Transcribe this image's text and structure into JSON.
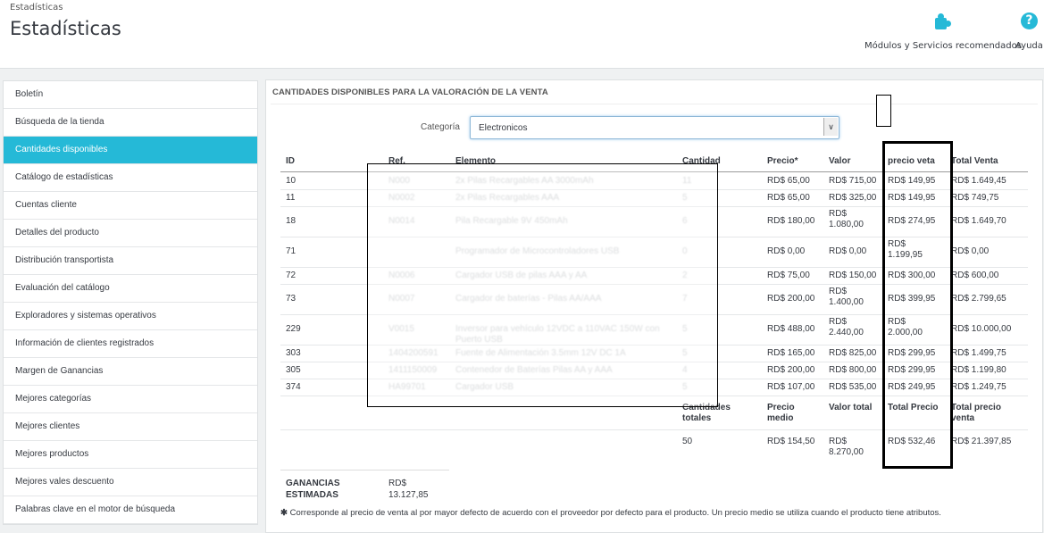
{
  "breadcrumb": "Estadísticas",
  "page_title": "Estadísticas",
  "toolbar": {
    "modules_label": "Módulos y Servicios recomendados",
    "help_label": "Ayuda",
    "modules_icon": "puzzle-icon",
    "help_icon": "question-circle-icon"
  },
  "colors": {
    "accent": "#25b9d7"
  },
  "sidebar": {
    "items": [
      {
        "label": "Boletín"
      },
      {
        "label": "Búsqueda de la tienda"
      },
      {
        "label": "Cantidades disponibles",
        "active": true
      },
      {
        "label": "Catálogo de estadísticas"
      },
      {
        "label": "Cuentas cliente"
      },
      {
        "label": "Detalles del producto"
      },
      {
        "label": "Distribución transportista"
      },
      {
        "label": "Evaluación del catálogo"
      },
      {
        "label": "Exploradores y sistemas operativos"
      },
      {
        "label": "Información de clientes registrados"
      },
      {
        "label": "Margen de Ganancias"
      },
      {
        "label": "Mejores categorías"
      },
      {
        "label": "Mejores clientes"
      },
      {
        "label": "Mejores productos"
      },
      {
        "label": "Mejores vales descuento"
      },
      {
        "label": "Palabras clave en el motor de búsqueda"
      }
    ]
  },
  "panel": {
    "title": "CANTIDADES DISPONIBLES PARA LA VALORACIÓN DE LA VENTA",
    "category_label": "Categoría",
    "category_value": "Electronicos"
  },
  "table": {
    "headers": [
      "ID",
      "Ref.",
      "Elemento",
      "Cantidad",
      "Precio*",
      "Valor",
      "precio veta",
      "Total Venta"
    ],
    "rows": [
      {
        "id": "10",
        "ref": "N000",
        "item": "2x Pilas Recargables AA 3000mAh",
        "qty": "11",
        "price": "RD$ 65,00",
        "value": "RD$ 715,00",
        "sale": "RD$ 149,95",
        "total": "RD$ 1.649,45"
      },
      {
        "id": "11",
        "ref": "N0002",
        "item": "2x Pilas Recargables AAA",
        "qty": "5",
        "price": "RD$ 65,00",
        "value": "RD$ 325,00",
        "sale": "RD$ 149,95",
        "total": "RD$ 749,75"
      },
      {
        "id": "18",
        "ref": "N0014",
        "item": "Pila Recargable 9V 450mAh",
        "qty": "6",
        "price": "RD$ 180,00",
        "value": "RD$ 1.080,00",
        "sale": "RD$ 274,95",
        "total": "RD$ 1.649,70"
      },
      {
        "id": "71",
        "ref": "",
        "item": "Programador de Microcontroladores USB",
        "qty": "0",
        "price": "RD$ 0,00",
        "value": "RD$ 0,00",
        "sale": "RD$ 1.199,95",
        "total": "RD$ 0,00"
      },
      {
        "id": "72",
        "ref": "N0006",
        "item": "Cargador USB de pilas AAA y AA",
        "qty": "2",
        "price": "RD$ 75,00",
        "value": "RD$ 150,00",
        "sale": "RD$ 300,00",
        "total": "RD$ 600,00"
      },
      {
        "id": "73",
        "ref": "N0007",
        "item": "Cargador de baterías - Pilas AA/AAA",
        "qty": "7",
        "price": "RD$ 200,00",
        "value": "RD$ 1.400,00",
        "sale": "RD$ 399,95",
        "total": "RD$ 2.799,65"
      },
      {
        "id": "229",
        "ref": "V0015",
        "item": "Inversor para vehículo 12VDC a 110VAC 150W con Puerto USB",
        "qty": "5",
        "price": "RD$ 488,00",
        "value": "RD$ 2.440,00",
        "sale": "RD$ 2.000,00",
        "total": "RD$ 10.000,00"
      },
      {
        "id": "303",
        "ref": "1404200591",
        "item": "Fuente de Alimentación 3.5mm 12V DC 1A",
        "qty": "5",
        "price": "RD$ 165,00",
        "value": "RD$ 825,00",
        "sale": "RD$ 299,95",
        "total": "RD$ 1.499,75"
      },
      {
        "id": "305",
        "ref": "1411150009",
        "item": "Contenedor de Baterías Pilas AA y AAA",
        "qty": "4",
        "price": "RD$ 200,00",
        "value": "RD$ 800,00",
        "sale": "RD$ 299,95",
        "total": "RD$ 1.199,80"
      },
      {
        "id": "374",
        "ref": "HA99701",
        "item": "Cargador USB",
        "qty": "5",
        "price": "RD$ 107,00",
        "value": "RD$ 535,00",
        "sale": "RD$ 249,95",
        "total": "RD$ 1.249,75"
      }
    ],
    "totals_headers": {
      "qty": "Cantidades totales",
      "price": "Precio medio",
      "value": "Valor total",
      "sale": "Total Precio",
      "total": "Total precio venta"
    },
    "totals": {
      "qty": "50",
      "price": "RD$ 154,50",
      "value": "RD$ 8.270,00",
      "sale": "RD$ 532,46",
      "total": "RD$ 21.397,85"
    }
  },
  "earnings": {
    "label": "GANANCIAS ESTIMADAS",
    "value": "RD$ 13.127,85"
  },
  "footnote": {
    "icon": "asterisk-icon",
    "text": "Corresponde al precio de venta al por mayor defecto de acuerdo con el proveedor por defecto para el producto. Un precio medio se utiliza cuando el producto tiene atributos."
  }
}
